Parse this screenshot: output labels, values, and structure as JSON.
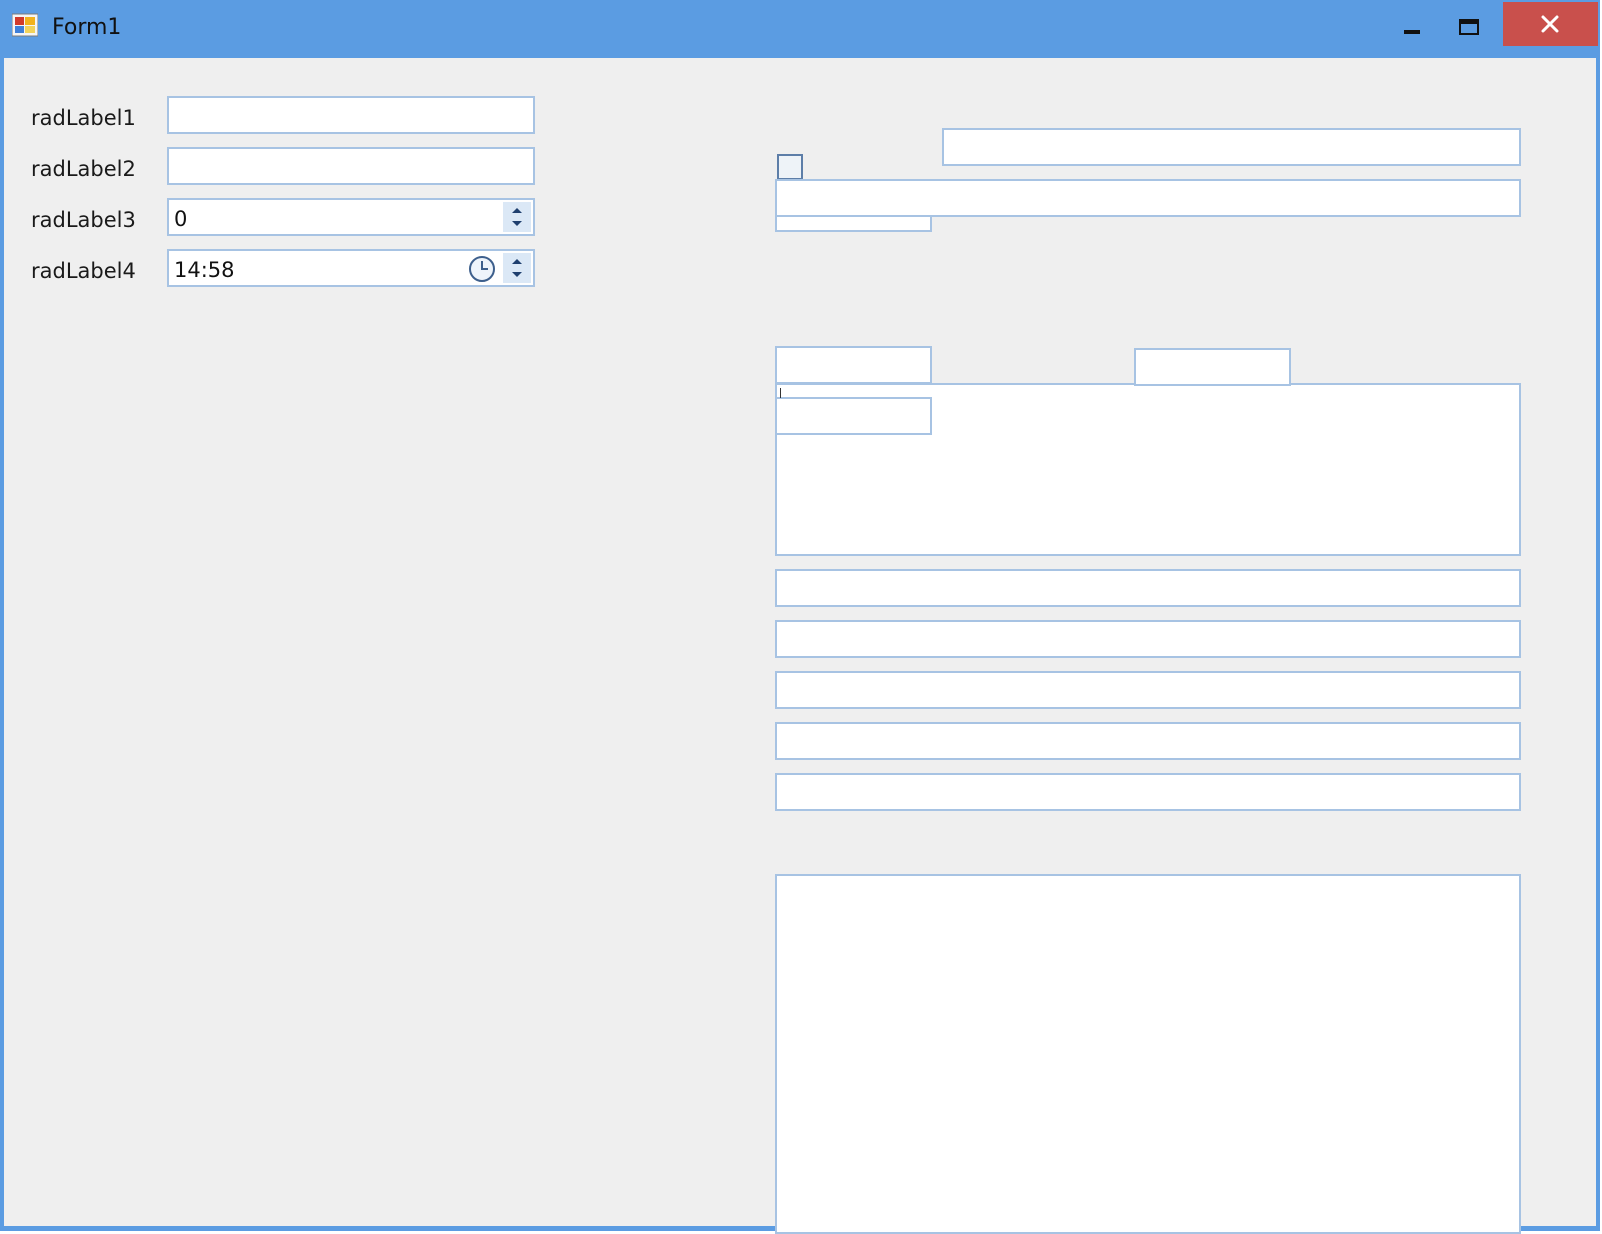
{
  "window": {
    "title": "Form1"
  },
  "titlebar": {
    "minimize_icon": "minimize-icon",
    "maximize_icon": "maximize-icon",
    "close_icon": "close-icon",
    "close_color": "#c9504c",
    "bar_color": "#5b9ce2"
  },
  "form": {
    "labels": {
      "label1": "radLabel1",
      "label2": "radLabel2",
      "label3": "radLabel3",
      "label4": "radLabel4"
    },
    "textbox1_value": "",
    "textbox2_value": "",
    "spin_value": "0",
    "time_value": "14:58"
  },
  "accent_border": "#a7c3e3"
}
